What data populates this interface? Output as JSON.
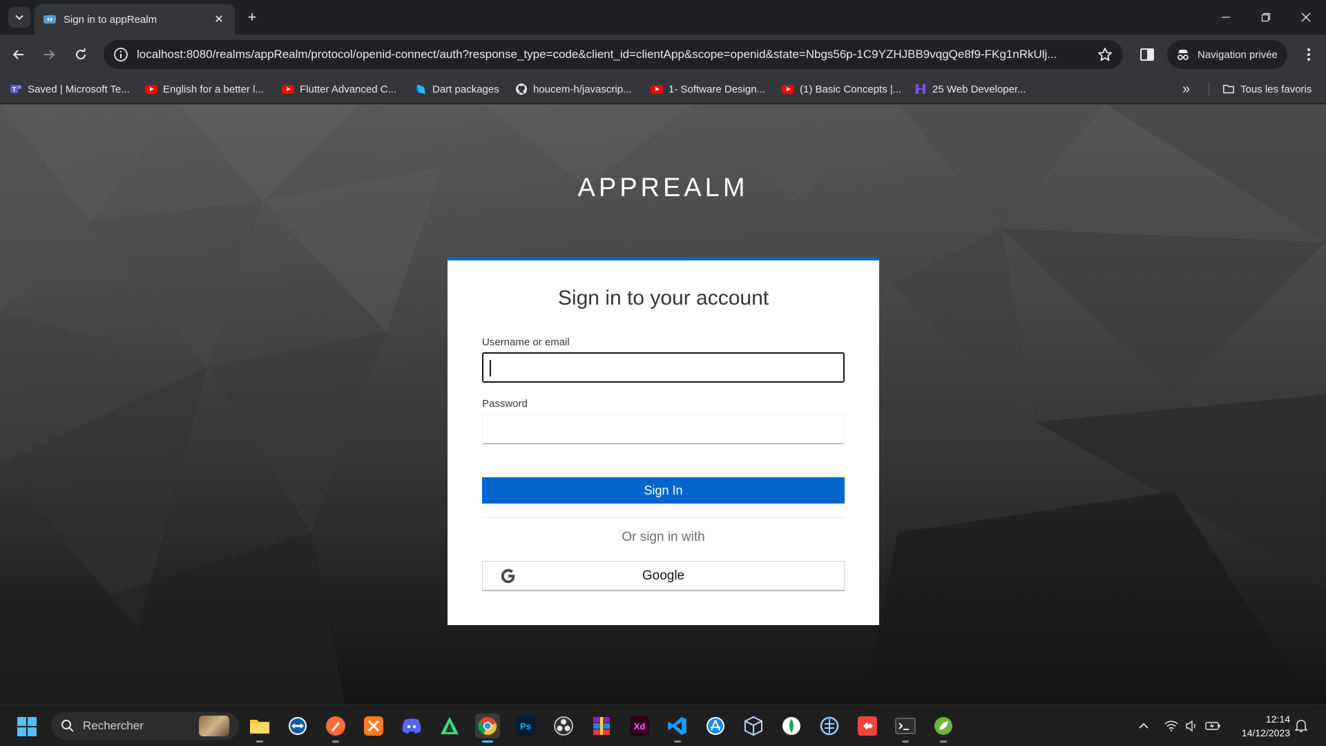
{
  "browser": {
    "tab_title": "Sign in to appRealm",
    "tab_close": "✕",
    "new_tab": "+",
    "url": "localhost:8080/realms/appRealm/protocol/openid-connect/auth?response_type=code&client_id=clientApp&scope=openid&state=Nbgs56p-1C9YZHJBB9vqgQe8f9-FKg1nRkUlj...",
    "incognito_label": "Navigation privée",
    "bookmarks": [
      {
        "label": "Saved | Microsoft Te...",
        "icon": "teams-icon"
      },
      {
        "label": "English for a better l...",
        "icon": "youtube-icon"
      },
      {
        "label": "Flutter Advanced C...",
        "icon": "youtube-icon"
      },
      {
        "label": "Dart packages",
        "icon": "dart-icon"
      },
      {
        "label": "houcem-h/javascrip...",
        "icon": "github-icon"
      },
      {
        "label": "1- Software Design...",
        "icon": "youtube-icon"
      },
      {
        "label": "(1) Basic Concepts |...",
        "icon": "youtube-icon"
      },
      {
        "label": "25 Web Developer...",
        "icon": "bookmark-site-icon"
      }
    ],
    "all_bookmarks_label": "Tous les favoris",
    "overflow_label": "»"
  },
  "page": {
    "realm_title": "APPREALM",
    "card_title": "Sign in to your account",
    "username_label": "Username or email",
    "username_value": "",
    "password_label": "Password",
    "password_value": "",
    "signin_label": "Sign In",
    "or_text": "Or sign in with",
    "google_label": "Google"
  },
  "taskbar": {
    "search_placeholder": "Rechercher",
    "apps": [
      "file-explorer",
      "teamviewer",
      "postman",
      "xampp",
      "discord",
      "android-studio",
      "chrome",
      "photoshop",
      "obs",
      "winrar",
      "adobe-xd",
      "vscode",
      "app-store",
      "virtualbox",
      "mongodb-compass",
      "network-tool",
      "anydesk",
      "terminal",
      "spring-tools"
    ],
    "time": "12:14",
    "date": "14/12/2023"
  },
  "colors": {
    "accent": "#0066cc",
    "chrome_dark": "#202124",
    "chrome_toolbar": "#35363a"
  }
}
